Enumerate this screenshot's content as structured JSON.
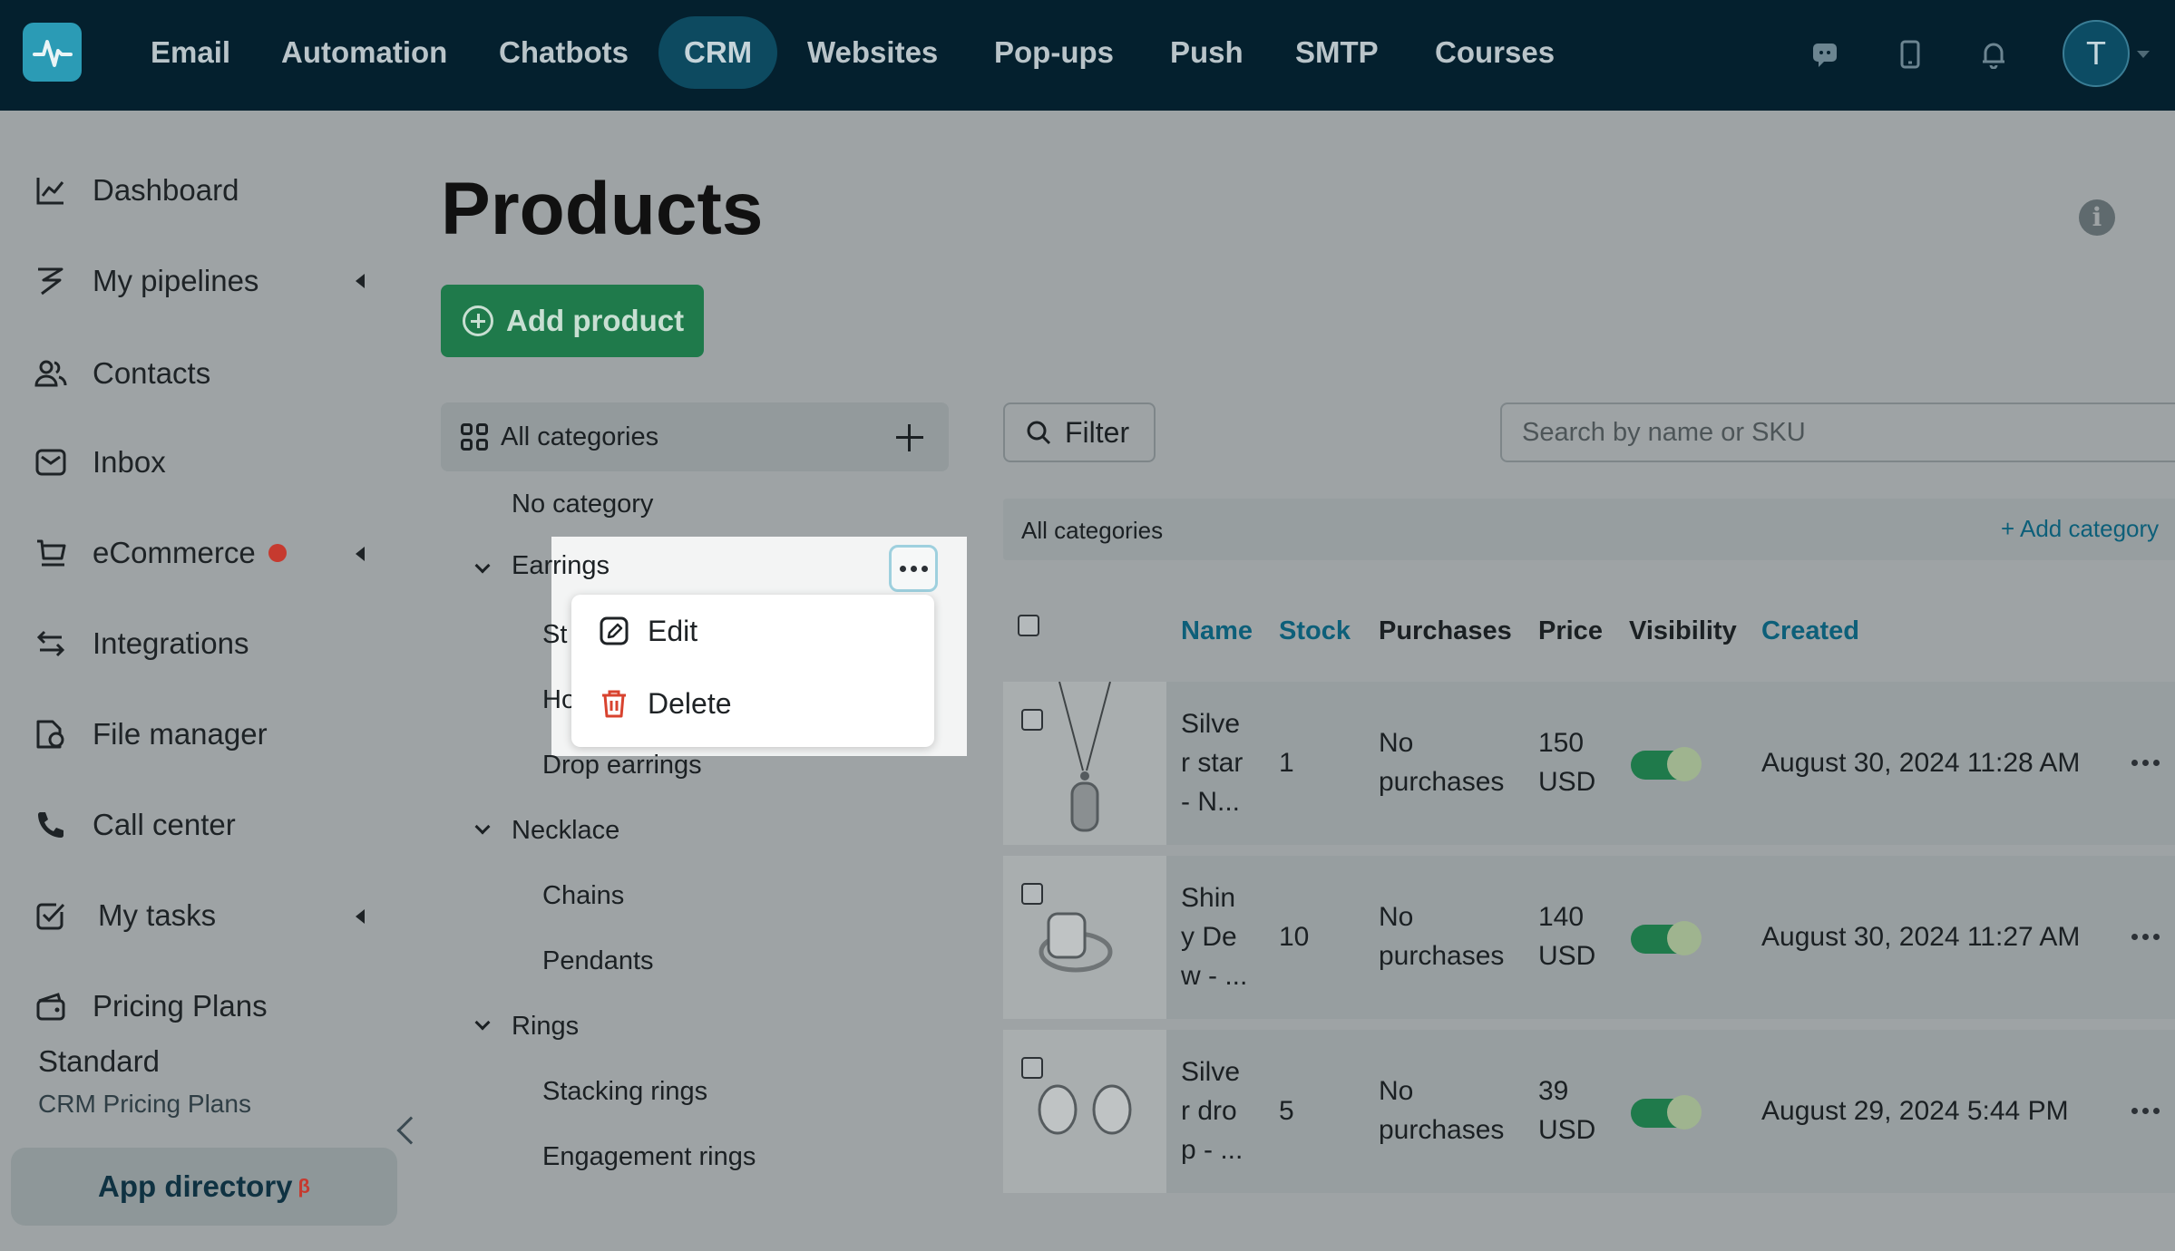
{
  "topnav": {
    "items": [
      "Email",
      "Automation",
      "Chatbots",
      "CRM",
      "Websites",
      "Pop-ups",
      "Push",
      "SMTP",
      "Courses"
    ],
    "active": "CRM",
    "avatar_letter": "T"
  },
  "sidebar": {
    "items": [
      {
        "label": "Dashboard",
        "icon": "chart-line-icon"
      },
      {
        "label": "My pipelines",
        "icon": "pipeline-icon"
      },
      {
        "label": "Contacts",
        "icon": "contacts-icon"
      },
      {
        "label": "Inbox",
        "icon": "inbox-icon"
      },
      {
        "label": "eCommerce",
        "icon": "cart-icon"
      },
      {
        "label": "Integrations",
        "icon": "arrows-icon"
      },
      {
        "label": "File manager",
        "icon": "file-manager-icon"
      },
      {
        "label": "Call center",
        "icon": "phone-icon"
      },
      {
        "label": "My tasks",
        "icon": "tasks-icon"
      },
      {
        "label": "Pricing Plans",
        "icon": "wallet-icon"
      }
    ],
    "plan_name": "Standard",
    "plan_link": "CRM Pricing Plans",
    "app_directory": "App directory",
    "app_directory_badge": "β"
  },
  "main": {
    "title": "Products",
    "add_product": "Add product"
  },
  "categories": {
    "header": "All categories",
    "tree": [
      {
        "label": "No category",
        "level": 0
      },
      {
        "label": "Earrings",
        "level": 0,
        "expanded": true
      },
      {
        "label": "St",
        "level": 1
      },
      {
        "label": "Ho",
        "level": 1
      },
      {
        "label": "Drop earrings",
        "level": 1
      },
      {
        "label": "Necklace",
        "level": 0,
        "expanded": true
      },
      {
        "label": "Chains",
        "level": 1
      },
      {
        "label": "Pendants",
        "level": 1
      },
      {
        "label": "Rings",
        "level": 0,
        "expanded": true
      },
      {
        "label": "Stacking rings",
        "level": 1
      },
      {
        "label": "Engagement rings",
        "level": 1
      }
    ]
  },
  "context_menu": {
    "edit": "Edit",
    "delete": "Delete"
  },
  "toolbar": {
    "filter": "Filter",
    "search_placeholder": "Search by name or SKU",
    "current_category": "All categories",
    "add_category": "+ Add category"
  },
  "table": {
    "columns": [
      "Name",
      "Stock",
      "Purchases",
      "Price",
      "Visibility",
      "Created"
    ],
    "rows": [
      {
        "name_lines": [
          "Silve",
          "r star",
          "- N..."
        ],
        "stock": "1",
        "purchases": [
          "No",
          "purchases"
        ],
        "price": [
          "150",
          "USD"
        ],
        "visible": true,
        "created": "August 30, 2024 11:28 AM"
      },
      {
        "name_lines": [
          "Shin",
          "y De",
          "w - ..."
        ],
        "stock": "10",
        "purchases": [
          "No",
          "purchases"
        ],
        "price": [
          "140",
          "USD"
        ],
        "visible": true,
        "created": "August 30, 2024 11:27 AM"
      },
      {
        "name_lines": [
          "Silve",
          "r dro",
          "p - ..."
        ],
        "stock": "5",
        "purchases": [
          "No",
          "purchases"
        ],
        "price": [
          "39",
          "USD"
        ],
        "visible": true,
        "created": "August 29, 2024 5:44 PM"
      }
    ]
  }
}
